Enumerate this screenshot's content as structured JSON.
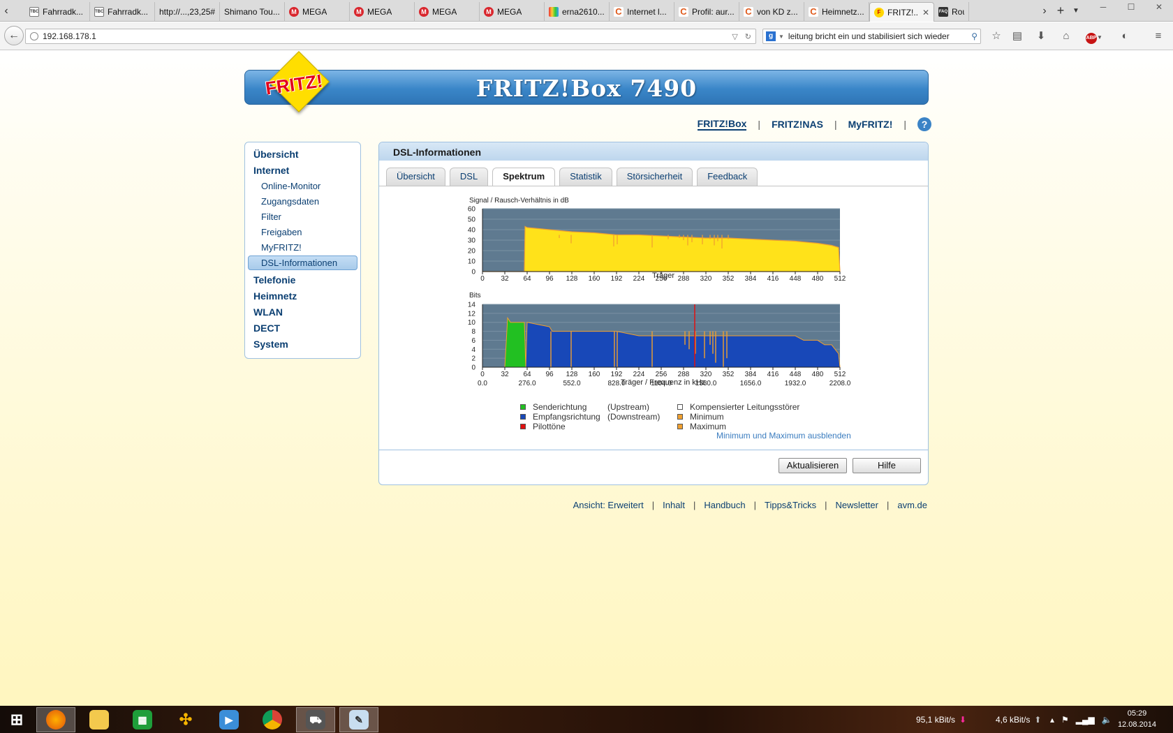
{
  "browser": {
    "tabs": [
      {
        "label": "Fahrradk...",
        "icon": "tbc-icon"
      },
      {
        "label": "Fahrradk...",
        "icon": "tbc-icon"
      },
      {
        "label": "http://...,23,25#",
        "icon": "none"
      },
      {
        "label": "Shimano Tou...",
        "icon": "none"
      },
      {
        "label": "MEGA",
        "icon": "mega-icon"
      },
      {
        "label": "MEGA",
        "icon": "mega-icon"
      },
      {
        "label": "MEGA",
        "icon": "mega-icon"
      },
      {
        "label": "MEGA",
        "icon": "mega-icon"
      },
      {
        "label": "erna2610...",
        "icon": "rainbow-icon"
      },
      {
        "label": "Internet l...",
        "icon": "cb-icon"
      },
      {
        "label": "Profil: aur...",
        "icon": "cb-icon"
      },
      {
        "label": "von KD z...",
        "icon": "cb-icon"
      },
      {
        "label": "Heimnetz...",
        "icon": "cb-icon"
      },
      {
        "label": "FRITZ!...",
        "icon": "fritz-icon",
        "active": true
      },
      {
        "label": "Rou",
        "icon": "faq-icon"
      }
    ],
    "url": "192.168.178.1",
    "search_engine_letter": "g",
    "search_query": "leitung bricht ein und stabilisiert sich wieder",
    "adblock_label": "ABP"
  },
  "header": {
    "product_title": "FRITZ!Box 7490",
    "logo_text": "FRITZ!",
    "topnav": [
      "FRITZ!Box",
      "FRITZ!NAS",
      "MyFRITZ!"
    ],
    "help_symbol": "?"
  },
  "sidebar": {
    "groups": [
      {
        "label": "Übersicht",
        "items": []
      },
      {
        "label": "Internet",
        "items": [
          "Online-Monitor",
          "Zugangsdaten",
          "Filter",
          "Freigaben",
          "MyFRITZ!",
          "DSL-Informationen"
        ]
      },
      {
        "label": "Telefonie",
        "items": []
      },
      {
        "label": "Heimnetz",
        "items": []
      },
      {
        "label": "WLAN",
        "items": []
      },
      {
        "label": "DECT",
        "items": []
      },
      {
        "label": "System",
        "items": []
      }
    ],
    "selected": "DSL-Informationen"
  },
  "content": {
    "title": "DSL-Informationen",
    "tabs": [
      "Übersicht",
      "DSL",
      "Spektrum",
      "Statistik",
      "Störsicherheit",
      "Feedback"
    ],
    "active_tab": "Spektrum",
    "legend": {
      "upstream": "Senderichtung",
      "upstream_note": "(Upstream)",
      "downstream": "Empfangsrichtung",
      "downstream_note": "(Downstream)",
      "pilot": "Pilottöne",
      "compensated": "Kompensierter Leitungsstörer",
      "minimum": "Minimum",
      "maximum": "Maximum"
    },
    "colors": {
      "upstream": "#22c022",
      "downstream": "#1848b8",
      "pilot": "#e01010",
      "compensated": "#ffffff",
      "minimum": "#f0a030",
      "maximum": "#f0a030",
      "snr_fill": "#ffe21a",
      "plot_bg": "#5f7a90"
    },
    "toggle_link": "Minimum und Maximum ausblenden",
    "buttons": {
      "refresh": "Aktualisieren",
      "help": "Hilfe"
    }
  },
  "chart_data": [
    {
      "type": "area",
      "ylabel": "Signal / Rausch-Verhältnis in dB",
      "xlabel": "Träger",
      "xlim": [
        0,
        512
      ],
      "ylim": [
        0,
        60
      ],
      "yticks": [
        0,
        10,
        20,
        30,
        40,
        50,
        60
      ],
      "xticks": [
        0,
        32,
        64,
        96,
        128,
        160,
        192,
        224,
        256,
        288,
        320,
        352,
        384,
        416,
        448,
        480,
        512
      ],
      "series": [
        {
          "x": [
            0,
            60,
            61,
            64,
            96,
            128,
            160,
            192,
            224,
            256,
            288,
            320,
            352,
            384,
            416,
            448,
            480,
            500,
            510,
            512
          ],
          "y": [
            0,
            0,
            43,
            42,
            40,
            38,
            37,
            35,
            35,
            34,
            33,
            32,
            32,
            31,
            30,
            29,
            27,
            25,
            23,
            0
          ]
        }
      ],
      "dips": [
        {
          "x": 110,
          "y": 32
        },
        {
          "x": 127,
          "y": 27
        },
        {
          "x": 188,
          "y": 24
        },
        {
          "x": 193,
          "y": 26
        },
        {
          "x": 243,
          "y": 23
        },
        {
          "x": 266,
          "y": 31
        },
        {
          "x": 282,
          "y": 32
        },
        {
          "x": 288,
          "y": 30
        },
        {
          "x": 294,
          "y": 25
        },
        {
          "x": 300,
          "y": 28
        },
        {
          "x": 315,
          "y": 26
        },
        {
          "x": 326,
          "y": 31
        },
        {
          "x": 332,
          "y": 25
        },
        {
          "x": 337,
          "y": 29
        },
        {
          "x": 343,
          "y": 22
        },
        {
          "x": 352,
          "y": 31
        }
      ]
    },
    {
      "type": "bar",
      "ylabel": "Bits",
      "xlabel": "Träger / Frequenz in kHz",
      "xlim": [
        0,
        512
      ],
      "ylim": [
        0,
        14
      ],
      "yticks": [
        0,
        2,
        4,
        6,
        8,
        10,
        12,
        14
      ],
      "xticks": [
        0,
        32,
        64,
        96,
        128,
        160,
        192,
        224,
        256,
        288,
        320,
        352,
        384,
        416,
        448,
        480,
        512
      ],
      "freq_ticks": [
        "0.0",
        "276.0",
        "552.0",
        "828.0",
        "1104.0",
        "1380.0",
        "1656.0",
        "1932.0",
        "2208.0"
      ],
      "series": [
        {
          "name": "Senderichtung",
          "x": [
            32,
            36,
            40,
            44,
            48,
            52,
            56,
            60,
            62
          ],
          "y": [
            0,
            11,
            10,
            10,
            10,
            10,
            10,
            10,
            0
          ]
        },
        {
          "name": "Empfangsrichtung",
          "x": [
            62,
            64,
            96,
            100,
            128,
            150,
            192,
            224,
            256,
            288,
            300,
            320,
            352,
            384,
            416,
            448,
            460,
            480,
            490,
            500,
            510,
            512
          ],
          "y": [
            0,
            10,
            9,
            8,
            8,
            8,
            8,
            7,
            7,
            7,
            7,
            7,
            7,
            7,
            7,
            7,
            6,
            6,
            5,
            5,
            3,
            0
          ]
        },
        {
          "name": "Pilottöne",
          "x": [
            304
          ],
          "y": [
            14
          ]
        }
      ],
      "dips": [
        {
          "x": 98,
          "y": 0
        },
        {
          "x": 108,
          "y": 8
        },
        {
          "x": 127,
          "y": 0
        },
        {
          "x": 189,
          "y": 0
        },
        {
          "x": 193,
          "y": 0
        },
        {
          "x": 243,
          "y": 0
        },
        {
          "x": 290,
          "y": 5
        },
        {
          "x": 296,
          "y": 4
        },
        {
          "x": 305,
          "y": 3
        },
        {
          "x": 318,
          "y": 2
        },
        {
          "x": 326,
          "y": 5
        },
        {
          "x": 330,
          "y": 3
        },
        {
          "x": 334,
          "y": 1
        },
        {
          "x": 345,
          "y": 0
        },
        {
          "x": 350,
          "y": 2
        }
      ]
    }
  ],
  "footer": {
    "links": [
      "Ansicht: Erweitert",
      "Inhalt",
      "Handbuch",
      "Tipps&Tricks",
      "Newsletter",
      "avm.de"
    ]
  },
  "taskbar": {
    "net_down": "95,1 kBit/s",
    "net_up": "4,6 kBit/s",
    "time": "05:29",
    "date": "12.08.2014"
  }
}
